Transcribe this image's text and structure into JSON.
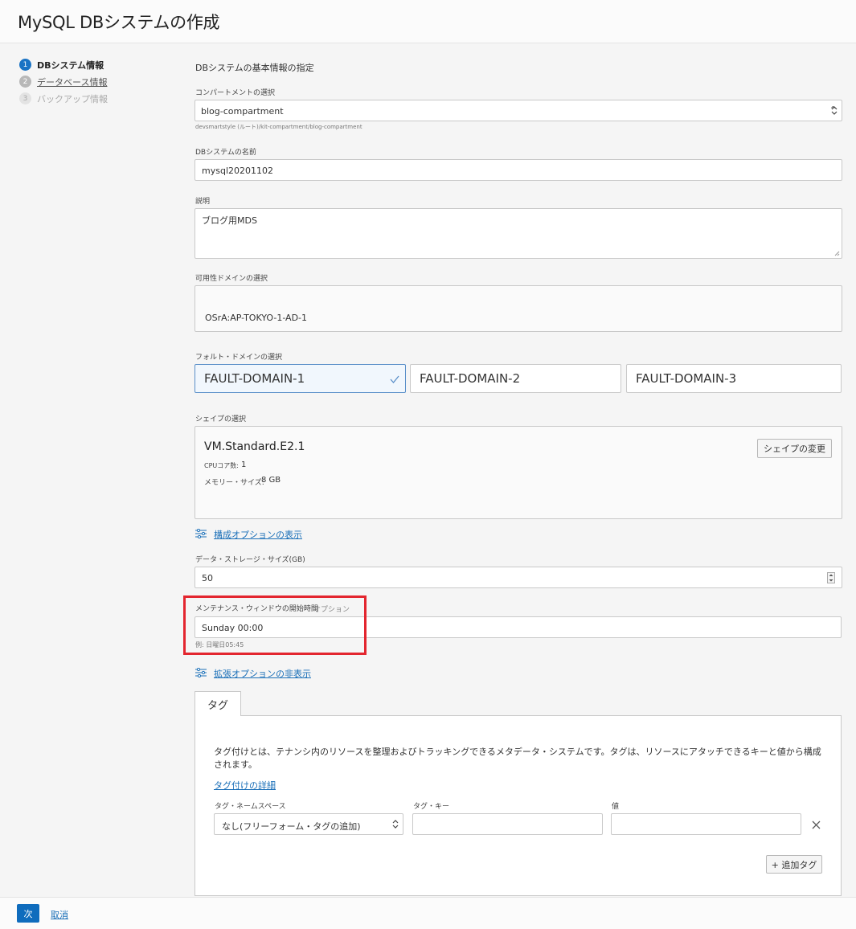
{
  "header": {
    "title": "MySQL DBシステムの作成"
  },
  "steps": [
    {
      "num": "1",
      "label": "DBシステム情報"
    },
    {
      "num": "2",
      "label": "データベース情報"
    },
    {
      "num": "3",
      "label": "バックアップ情報"
    }
  ],
  "form": {
    "section_title": "DBシステムの基本情報の指定",
    "compartment": {
      "label": "コンパートメントの選択",
      "value": "blog-compartment",
      "hint": "devsmartstyle (ルート)/kit-compartment/blog-compartment"
    },
    "name": {
      "label": "DBシステムの名前",
      "value": "mysql20201102"
    },
    "description": {
      "label": "説明",
      "value": "ブログ用MDS"
    },
    "availability_domain": {
      "label": "可用性ドメインの選択",
      "value": "OSrA:AP-TOKYO-1-AD-1"
    },
    "fault_domain": {
      "label": "フォルト・ドメインの選択",
      "options": [
        "FAULT-DOMAIN-1",
        "FAULT-DOMAIN-2",
        "FAULT-DOMAIN-3"
      ],
      "selected": "FAULT-DOMAIN-1"
    },
    "shape": {
      "label": "シェイプの選択",
      "name": "VM.Standard.E2.1",
      "cpu_label": "CPUコア数:",
      "cpu_value": "1",
      "memory_label": "メモリー・サイズ:",
      "memory_value": "8 GB",
      "change_button": "シェイプの変更"
    },
    "show_config_options": "構成オプションの表示",
    "storage": {
      "label": "データ・ストレージ・サイズ(GB)",
      "value": "50"
    },
    "maintenance": {
      "label": "メンテナンス・ウィンドウの開始時間",
      "optional": "オプション",
      "value": "Sunday 00:00",
      "hint": "例: 日曜日05:45"
    },
    "hide_advanced_options": "拡張オプションの非表示"
  },
  "tags": {
    "tab_label": "タグ",
    "description": "タグ付けとは、テナンシ内のリソースを整理およびトラッキングできるメタデータ・システムです。タグは、リソースにアタッチできるキーと値から構成されます。",
    "details_link": "タグ付けの詳細",
    "namespace_label": "タグ・ネームスペース",
    "namespace_value": "なし(フリーフォーム・タグの追加)",
    "key_label": "タグ・キー",
    "key_value": "",
    "value_label": "値",
    "value_value": "",
    "add_tag_button": "+ 追加タグ"
  },
  "footer": {
    "next_button": "次",
    "cancel_link": "取消"
  },
  "colors": {
    "primary": "#0f6cbd",
    "highlight": "#e3262f",
    "link": "#1a6fb8"
  }
}
